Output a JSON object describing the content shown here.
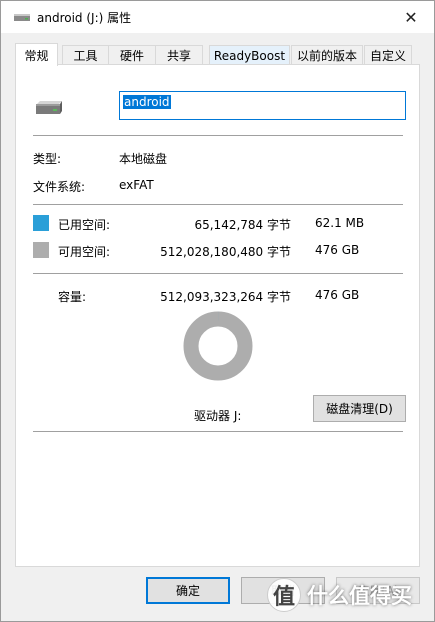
{
  "window": {
    "title": "android (J:) 属性",
    "close_glyph": "✕"
  },
  "tabs": [
    {
      "label": "常规",
      "active": true
    },
    {
      "label": "工具",
      "active": false
    },
    {
      "label": "硬件",
      "active": false
    },
    {
      "label": "共享",
      "active": false
    },
    {
      "label": "ReadyBoost",
      "active": false
    },
    {
      "label": "以前的版本",
      "active": false
    },
    {
      "label": "自定义",
      "active": false
    }
  ],
  "general": {
    "drive_name": "android",
    "type_label": "类型:",
    "type_value": "本地磁盘",
    "fs_label": "文件系统:",
    "fs_value": "exFAT",
    "used_label": "已用空间:",
    "used_bytes": "65,142,784 字节",
    "used_human": "62.1 MB",
    "free_label": "可用空间:",
    "free_bytes": "512,028,180,480 字节",
    "free_human": "476 GB",
    "capacity_label": "容量:",
    "capacity_bytes": "512,093,323,264 字节",
    "capacity_human": "476 GB",
    "drive_label": "驱动器 J:",
    "cleanup_button": "磁盘清理(D)",
    "used_fraction": 0.000127
  },
  "colors": {
    "used": "#2a9fd8",
    "free": "#adadad",
    "accent": "#0078d7"
  },
  "footer": {
    "ok": "确定",
    "cancel": "取消",
    "apply": "应用(A)"
  },
  "watermark": {
    "badge": "值",
    "text": "什么值得买"
  }
}
